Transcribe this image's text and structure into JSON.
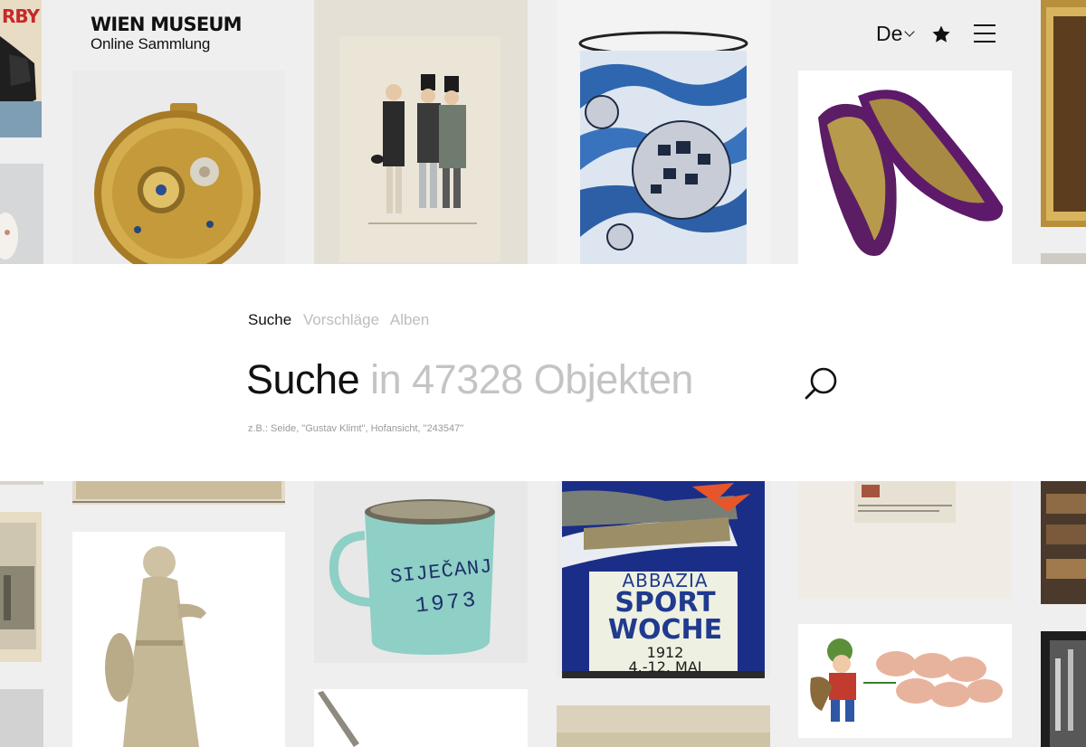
{
  "header": {
    "logo_line1": "WIEN MUSEUM",
    "logo_line2": "Online Sammlung",
    "language": "De",
    "favorites_icon": "star-icon",
    "menu_icon": "menu-icon"
  },
  "search": {
    "tabs": [
      {
        "label": "Suche",
        "active": true
      },
      {
        "label": "Vorschläge",
        "active": false
      },
      {
        "label": "Alben",
        "active": false
      }
    ],
    "term": "Suche",
    "placeholder_hint": " in 47328 Objekten",
    "examples": "z.B.: Seide, \"Gustav Klimt\", Hofansicht, \"243547\"",
    "search_icon": "search-icon"
  },
  "grid": {
    "poster_fragment_text": "RBY",
    "mug_text_line1": "SIJEČANJ",
    "mug_text_line2": "1973",
    "poster_line1": "ABBAZIA",
    "poster_line2": "SPORT",
    "poster_line3": "WOCHE",
    "poster_line4": "1912",
    "poster_line5": "4.-12. MAI"
  },
  "colors": {
    "background": "#efefef",
    "panel": "#ffffff",
    "text": "#111111",
    "muted": "#c4c4c4"
  }
}
